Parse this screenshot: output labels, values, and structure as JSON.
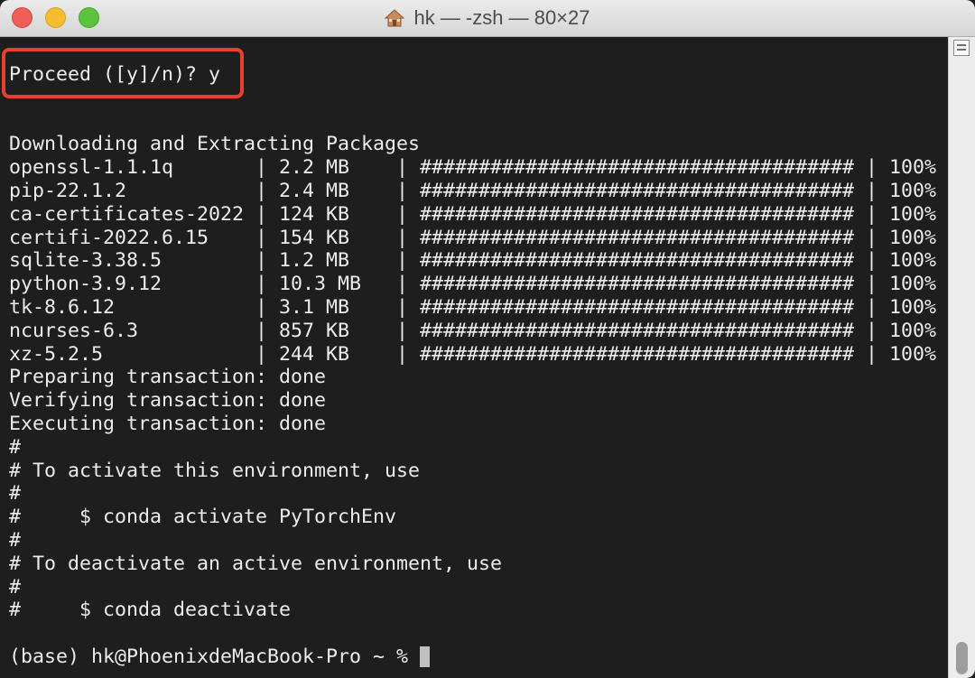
{
  "window": {
    "title": "hk — -zsh — 80×27"
  },
  "terminal": {
    "lines": [
      "Proceed ([y]/n)? y",
      "",
      "",
      "Downloading and Extracting Packages",
      "openssl-1.1.1q       | 2.2 MB    | ##################################### | 100%",
      "pip-22.1.2           | 2.4 MB    | ##################################### | 100%",
      "ca-certificates-2022 | 124 KB    | ##################################### | 100%",
      "certifi-2022.6.15    | 154 KB    | ##################################### | 100%",
      "sqlite-3.38.5        | 1.2 MB    | ##################################### | 100%",
      "python-3.9.12        | 10.3 MB   | ##################################### | 100%",
      "tk-8.6.12            | 3.1 MB    | ##################################### | 100%",
      "ncurses-6.3          | 857 KB    | ##################################### | 100%",
      "xz-5.2.5             | 244 KB    | ##################################### | 100%",
      "Preparing transaction: done",
      "Verifying transaction: done",
      "Executing transaction: done",
      "#",
      "# To activate this environment, use",
      "#",
      "#     $ conda activate PyTorchEnv",
      "#",
      "# To deactivate an active environment, use",
      "#",
      "#     $ conda deactivate",
      "",
      "(base) hk@PhoenixdeMacBook-Pro ~ % "
    ]
  },
  "colors": {
    "highlight_border": "#e8402f",
    "terminal_bg": "#1e1e1e",
    "terminal_fg": "#ececec"
  }
}
